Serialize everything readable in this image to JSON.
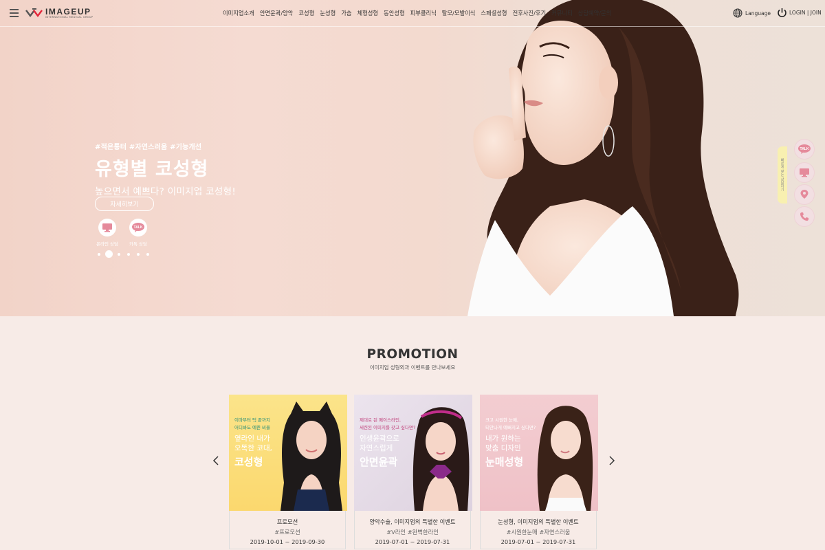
{
  "header": {
    "logo_text": "IMAGEUP",
    "logo_sub": "INTERNATIONAL MEDICAL GROUP",
    "nav": [
      "이미지업소개",
      "안면윤곽/양악",
      "코성형",
      "눈성형",
      "가슴",
      "체형성형",
      "동안성형",
      "피부클리닉",
      "탈모/모발이식",
      "스페셜성형",
      "전후사진/후기",
      "커뮤니티",
      "상담예약/문의"
    ],
    "language_label": "Language",
    "login_label": "LOGIN | JOIN"
  },
  "hero": {
    "tags": "#적은통터 #자연스러움 #기능개선",
    "title": "유형별 코성형",
    "subtitle": "높으면서 예쁘다? 이미지업 코성형!",
    "detail_button": "자세히보기",
    "consult_online": "온라인 상담",
    "consult_kakao": "카톡 상담",
    "kakao_icon_text": "TALK",
    "slide_count": 6,
    "active_slide": 2
  },
  "quick_menu": {
    "tab_label": "빠르게 찾는 상담하기",
    "talk_text": "TALK"
  },
  "promotion": {
    "title": "PROMOTION",
    "subtitle": "이미지업 성형외과 이벤트를 만나보세요",
    "cards": [
      {
        "cap1": "이마부터 턱 끝까지",
        "cap1b": "어디봐도 예쁜 비율",
        "cap2": "옆라인 내가",
        "cap2b": "오똑한 코대,",
        "cap3": "코성형",
        "title": "프로모션",
        "tags": "#프로모션",
        "dates": "2019-10-01 ~ 2019-09-30"
      },
      {
        "cap1": "제대로 된 페이스라인,",
        "cap1b": "세련된 이미지를 갖고 싶다면?",
        "cap2": "인생윤곽으로",
        "cap2b": "자연스럽게",
        "cap3": "안면윤곽",
        "title": "양악수술, 이미지업의 특별한 이벤트",
        "tags": "#V라인 #완벽한라인",
        "dates": "2019-07-01 ~ 2019-07-31"
      },
      {
        "cap1": "크고 시원한 눈매,",
        "cap1b": "티안나게 예뻐지고 싶다면?",
        "cap2": "내가 원하는",
        "cap2b": "맞춤 디자인",
        "cap3": "눈매성형",
        "title": "눈성형, 이미지업의 특별한 이벤트",
        "tags": "#시원한눈매 #자연스러움",
        "dates": "2019-07-01 ~ 2019-07-31"
      }
    ]
  },
  "colors": {
    "hero_bg": "#f3d7cc",
    "page_bg": "#f7ebe7",
    "brand_red": "#e3263a",
    "quick_tab": "#f8f0b0",
    "card1_bg": "#fbe07e",
    "card2_bg": "#e6dce5",
    "card3_bg": "#f1c8cd"
  }
}
